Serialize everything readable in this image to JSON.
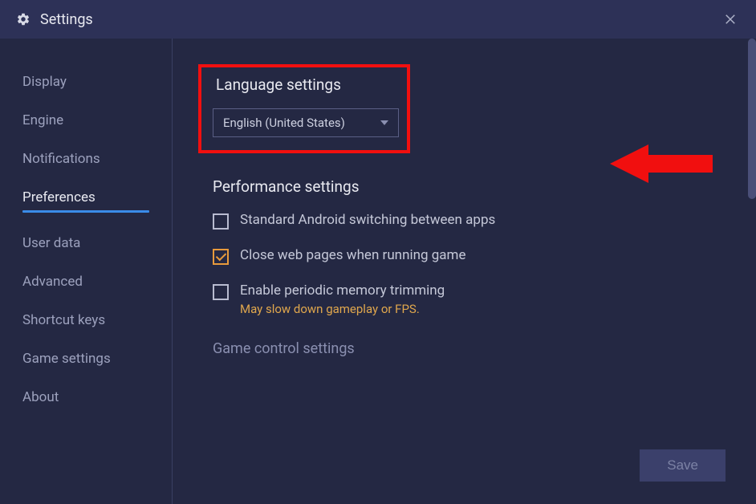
{
  "titlebar": {
    "title": "Settings"
  },
  "sidebar": {
    "items": [
      {
        "label": "Display",
        "active": false
      },
      {
        "label": "Engine",
        "active": false
      },
      {
        "label": "Notifications",
        "active": false
      },
      {
        "label": "Preferences",
        "active": true
      },
      {
        "label": "User data",
        "active": false
      },
      {
        "label": "Advanced",
        "active": false
      },
      {
        "label": "Shortcut keys",
        "active": false
      },
      {
        "label": "Game settings",
        "active": false
      },
      {
        "label": "About",
        "active": false
      }
    ]
  },
  "main": {
    "language_section": {
      "title": "Language settings",
      "selected": "English (United States)"
    },
    "performance_section": {
      "title": "Performance settings",
      "options": [
        {
          "label": "Standard Android switching between apps",
          "checked": false,
          "sublabel": ""
        },
        {
          "label": "Close web pages when running game",
          "checked": true,
          "sublabel": ""
        },
        {
          "label": "Enable periodic memory trimming",
          "checked": false,
          "sublabel": "May slow down gameplay or FPS."
        }
      ]
    },
    "game_control_section": {
      "title": "Game control settings"
    },
    "save_button": "Save"
  },
  "annotation": {
    "highlight_color": "#f10f0f"
  }
}
